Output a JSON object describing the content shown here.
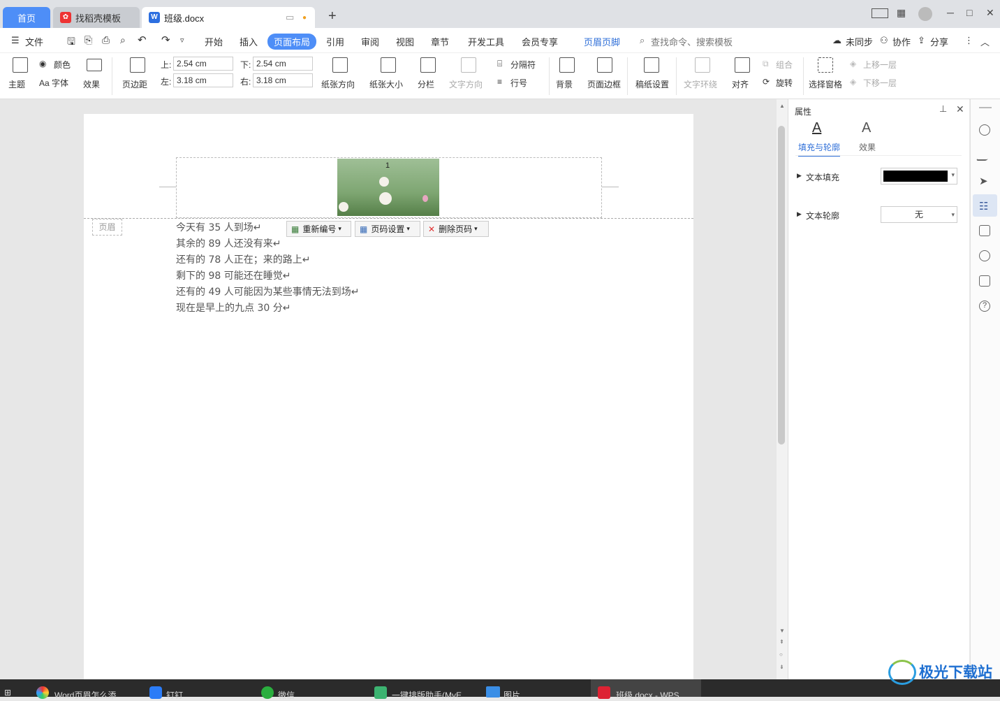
{
  "tabs": {
    "home": "首页",
    "find": "找稻壳模板",
    "doc": "班级.docx",
    "plus": "+"
  },
  "window_controls": {
    "minimize": "─",
    "maximize": "□",
    "close": "✕"
  },
  "menu": {
    "file": "文件",
    "start": "开始",
    "insert": "插入",
    "layout": "页面布局",
    "reference": "引用",
    "review": "审阅",
    "view": "视图",
    "chapter": "章节",
    "dev": "开发工具",
    "member": "会员专享",
    "header_footer": "页眉页脚",
    "search": "查找命令、搜索模板",
    "sync": "未同步",
    "collab": "协作",
    "share": "分享"
  },
  "ribbon": {
    "theme": "主题",
    "color": "颜色",
    "font": "Aa 字体",
    "effect": "效果",
    "margin": "页边距",
    "top_label": "上:",
    "top_val": "2.54 cm",
    "bottom_label": "下:",
    "bottom_val": "2.54 cm",
    "left_label": "左:",
    "left_val": "3.18 cm",
    "right_label": "右:",
    "right_val": "3.18 cm",
    "orientation": "纸张方向",
    "size": "纸张大小",
    "columns": "分栏",
    "text_dir": "文字方向",
    "separator": "分隔符",
    "line_no": "行号",
    "background": "背景",
    "border": "页面边框",
    "manuscript": "稿纸设置",
    "wrap": "文字环绕",
    "align": "对齐",
    "group": "组合",
    "rotate": "旋转",
    "select_pane": "选择窗格",
    "up": "上移一层",
    "down": "下移一层"
  },
  "document": {
    "page_number": "1",
    "header_label": "页眉",
    "lines": [
      "今天有 35 人到场↵",
      "其余的 89 人还没有来↵",
      "还有的 78 人正在；来的路上↵",
      "剩下的 98 可能还在睡觉↵",
      "还有的 49 人可能因为某些事情无法到场↵",
      "现在是早上的九点 30 分↵"
    ]
  },
  "header_tools": {
    "renumber": "重新编号",
    "page_setup": "页码设置",
    "delete": "删除页码"
  },
  "panel": {
    "title": "属性",
    "tab_fill": "填充与轮廓",
    "tab_effect": "效果",
    "fill_label": "文本填充",
    "outline_label": "文本轮廓",
    "outline_value": "无",
    "fill_color": "#000000"
  },
  "taskbar": [
    "Word页眉怎么添",
    "钉钉",
    "微信",
    "一键排版助手(MyE",
    "图片",
    "班级.docx - WPS"
  ],
  "watermark": "极光下载站",
  "accent": "#4e8ef7"
}
